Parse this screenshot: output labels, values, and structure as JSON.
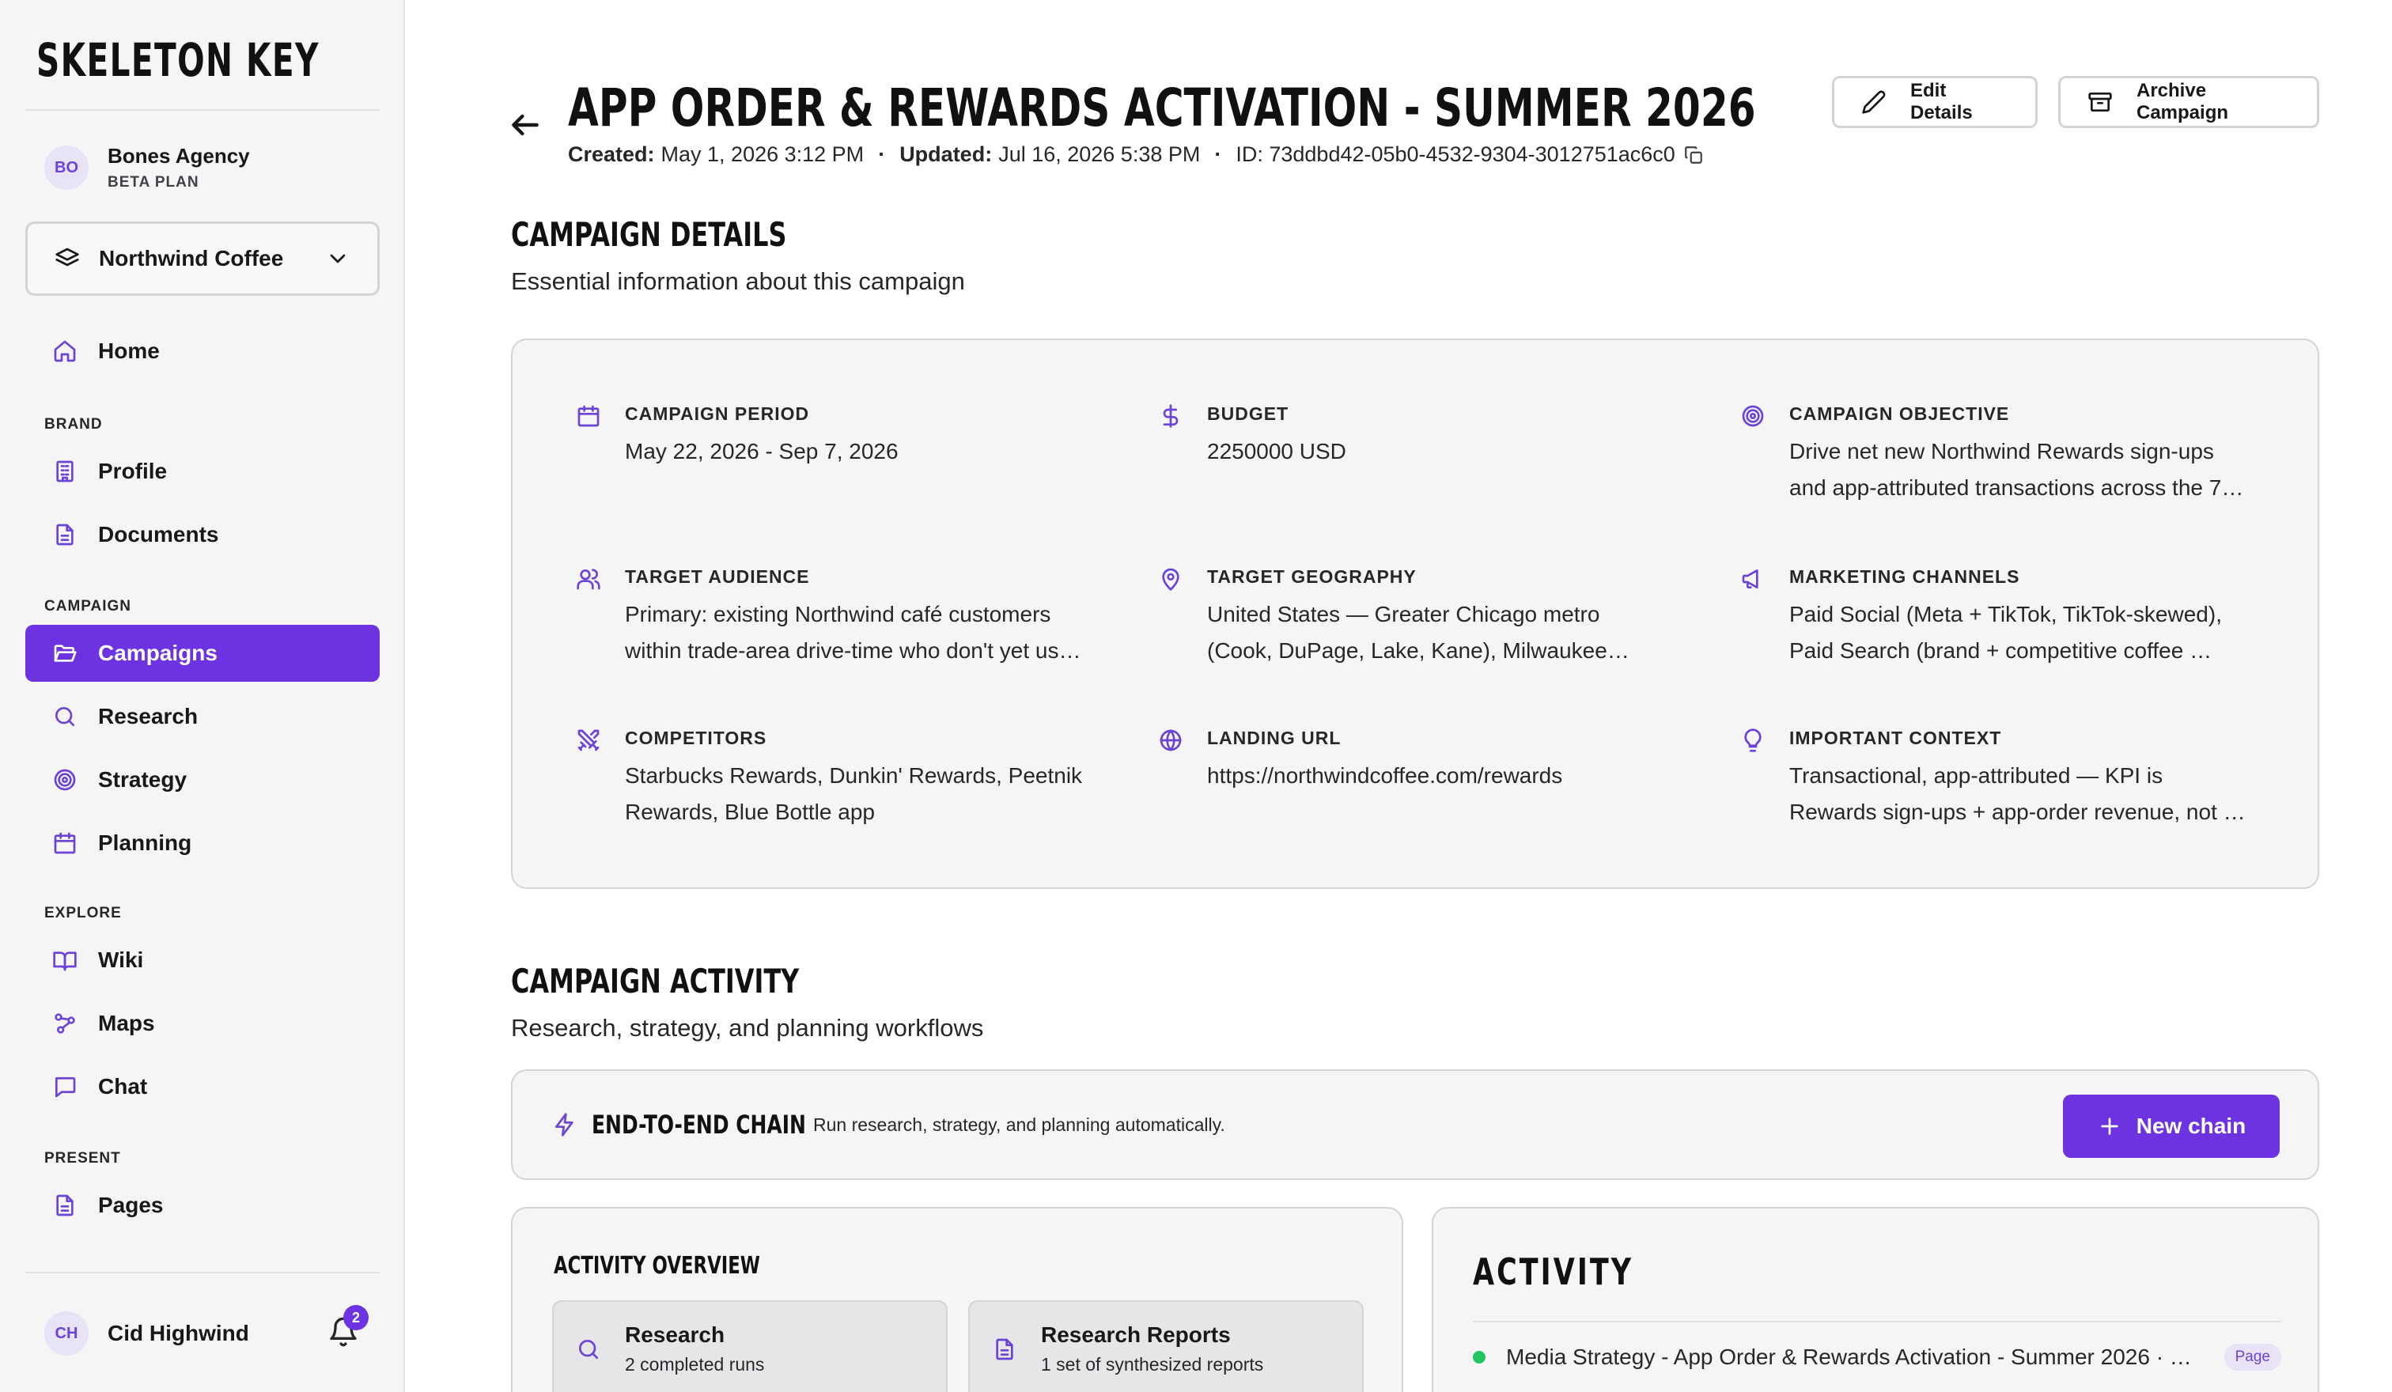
{
  "app": {
    "logo_text": "SKELETON KEY"
  },
  "sidebar": {
    "agency": {
      "initials": "BO",
      "name": "Bones Agency",
      "plan": "BETA PLAN"
    },
    "brand_select": {
      "label": "Northwind Coffee",
      "icon": "layers-icon"
    },
    "home": {
      "label": "Home",
      "icon": "home-icon"
    },
    "sections": {
      "brand": "BRAND",
      "campaign": "CAMPAIGN",
      "explore": "EXPLORE",
      "present": "PRESENT"
    },
    "items": {
      "profile": "Profile",
      "documents": "Documents",
      "campaigns": "Campaigns",
      "research": "Research",
      "strategy": "Strategy",
      "planning": "Planning",
      "wiki": "Wiki",
      "maps": "Maps",
      "chat": "Chat",
      "pages": "Pages"
    },
    "active_item": "campaigns",
    "user": {
      "initials": "CH",
      "name": "Cid Highwind",
      "notifications": "2"
    }
  },
  "header": {
    "title": "APP ORDER & REWARDS ACTIVATION - SUMMER 2026",
    "created_label": "Created:",
    "created_value": "May 1, 2026 3:12 PM",
    "updated_label": "Updated:",
    "updated_value": "Jul 16, 2026 5:38 PM",
    "id_text": "ID: 73ddbd42-05b0-4532-9304-3012751ac6c0",
    "edit_button": "Edit Details",
    "archive_button": "Archive Campaign"
  },
  "campaign_details": {
    "title": "CAMPAIGN DETAILS",
    "subtitle": "Essential information about this campaign",
    "fields": [
      {
        "label": "CAMPAIGN PERIOD",
        "value": "May 22, 2026 - Sep 7, 2026",
        "icon": "calendar-icon"
      },
      {
        "label": "BUDGET",
        "value": "2250000 USD",
        "icon": "dollar-icon"
      },
      {
        "label": "CAMPAIGN OBJECTIVE",
        "value": "Drive net new Northwind Rewards sign-ups and app-attributed transactions across the 7…",
        "icon": "target-icon"
      },
      {
        "label": "TARGET AUDIENCE",
        "value": "Primary: existing Northwind café customers within trade-area drive-time who don't yet us…",
        "icon": "users-icon"
      },
      {
        "label": "TARGET GEOGRAPHY",
        "value": "United States — Greater Chicago metro (Cook, DuPage, Lake, Kane), Milwaukee metro, …",
        "icon": "map-pin-icon"
      },
      {
        "label": "MARKETING CHANNELS",
        "value": "Paid Social (Meta + TikTok, TikTok-skewed), Paid Search (brand + competitive coffee …",
        "icon": "megaphone-icon"
      },
      {
        "label": "COMPETITORS",
        "value": "Starbucks Rewards, Dunkin' Rewards, Peetnik Rewards, Blue Bottle app",
        "icon": "swords-icon"
      },
      {
        "label": "LANDING URL",
        "value": "https://northwindcoffee.com/rewards",
        "icon": "globe-icon"
      },
      {
        "label": "IMPORTANT CONTEXT",
        "value": "Transactional, app-attributed — KPI is Rewards sign-ups + app-order revenue, not …",
        "icon": "lightbulb-icon"
      }
    ]
  },
  "campaign_activity": {
    "title": "CAMPAIGN ACTIVITY",
    "subtitle": "Research, strategy, and planning workflows",
    "chain": {
      "title": "END-TO-END CHAIN",
      "description": "Run research, strategy, and planning automatically.",
      "button": "New chain"
    },
    "overview": {
      "title": "ACTIVITY OVERVIEW",
      "tiles": [
        {
          "title": "Research",
          "subtitle": "2 completed runs",
          "icon": "search-icon"
        },
        {
          "title": "Research Reports",
          "subtitle": "1 set of synthesized reports",
          "icon": "document-icon"
        }
      ]
    },
    "activity": {
      "title": "ACTIVITY",
      "items": [
        {
          "text": "Media Strategy - App Order & Rewards Activation - Summer 2026 · Co…",
          "badge": "Page"
        }
      ]
    }
  },
  "colors": {
    "accent": "#6d33e0",
    "sidebar_bg": "#f5f5f5",
    "card_bg": "#f5f5f5",
    "status_dot": "#22c55e"
  }
}
